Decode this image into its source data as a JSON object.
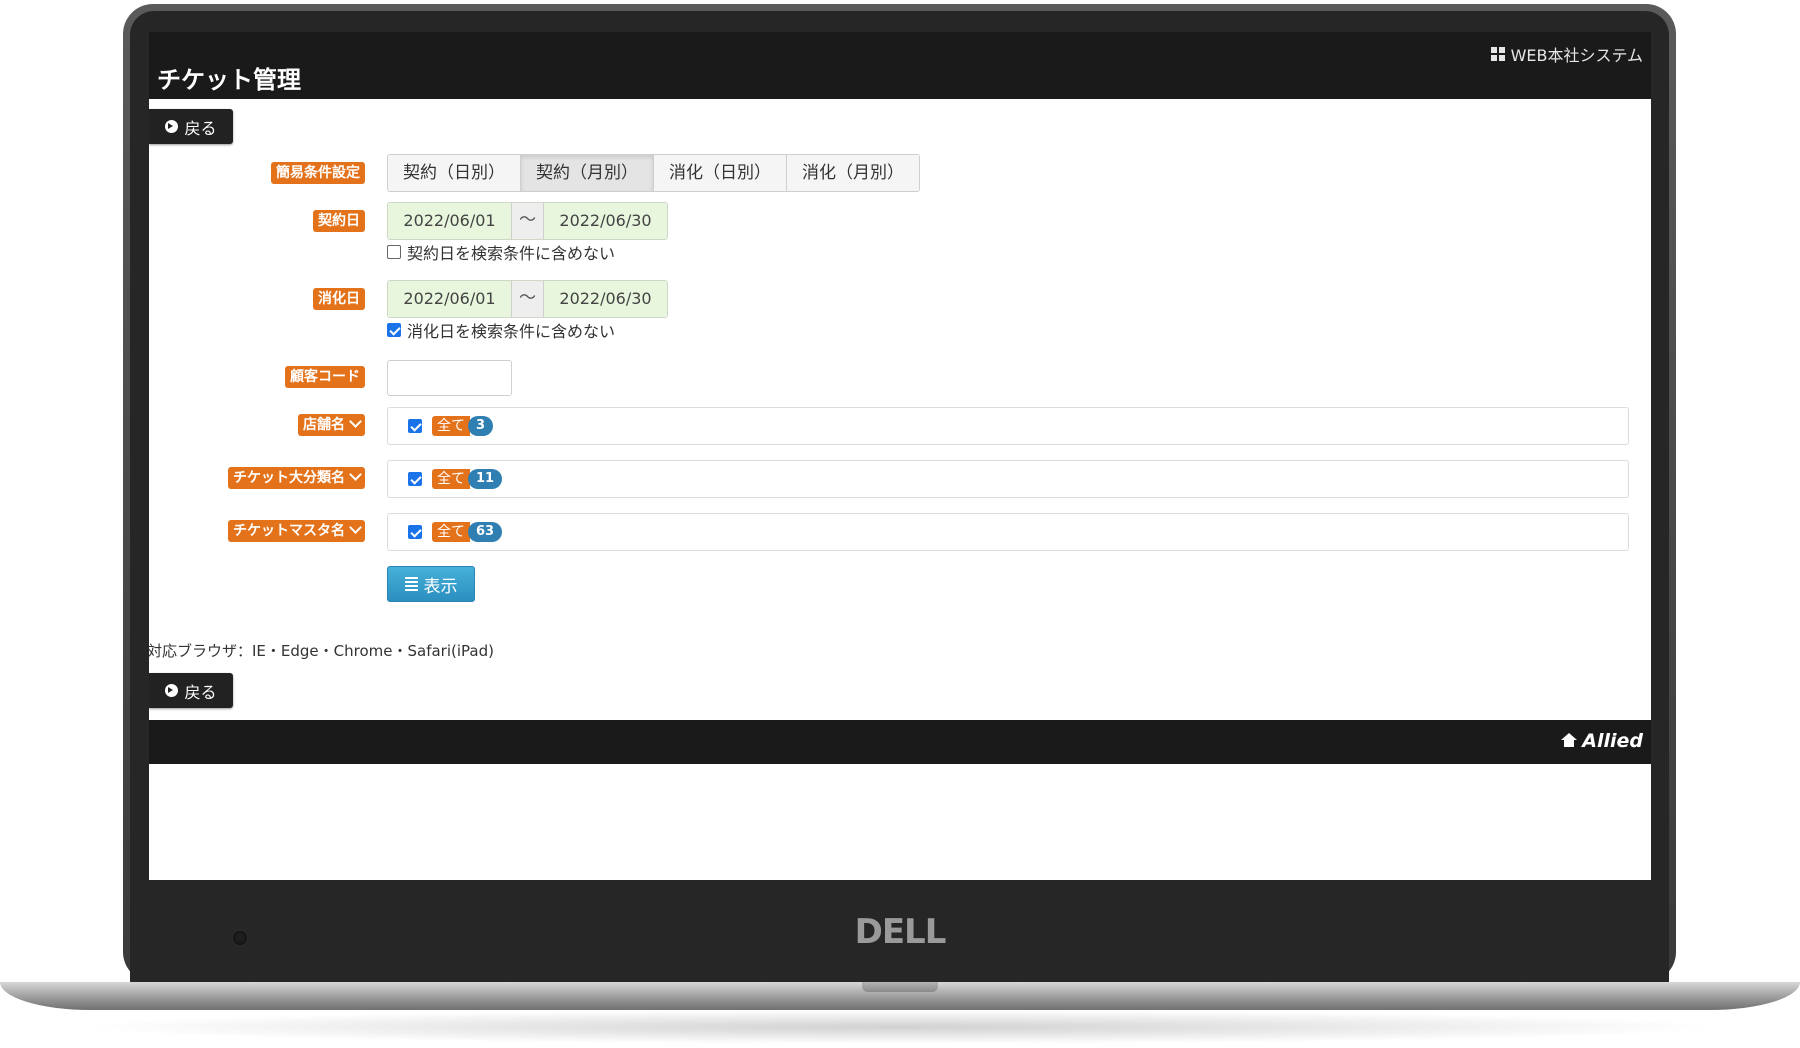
{
  "header": {
    "title": "チケット管理",
    "system_link": "WEB本社システム"
  },
  "back_label": "戻る",
  "quick_filter": {
    "label": "簡易条件設定",
    "options": [
      "契約（日別）",
      "契約（月別）",
      "消化（日別）",
      "消化（月別）"
    ],
    "selected": "契約（月別）"
  },
  "contract_date": {
    "label": "契約日",
    "from": "2022/06/01",
    "separator": "～",
    "to": "2022/06/30",
    "exclude_label": "契約日を検索条件に含めない",
    "exclude_checked": false
  },
  "consume_date": {
    "label": "消化日",
    "from": "2022/06/01",
    "separator": "～",
    "to": "2022/06/30",
    "exclude_label": "消化日を検索条件に含めない",
    "exclude_checked": true
  },
  "customer_code": {
    "label": "顧客コード",
    "value": ""
  },
  "store": {
    "label": "店舗名",
    "all_label": "全て",
    "count": "3"
  },
  "ticket_category": {
    "label": "チケット大分類名",
    "all_label": "全て",
    "count": "11"
  },
  "ticket_master": {
    "label": "チケットマスタ名",
    "all_label": "全て",
    "count": "63"
  },
  "show_button": "表示",
  "browser_note": "対応ブラウザ：IE・Edge・Chrome・Safari(iPad)",
  "footer": {
    "brand": "Allied"
  },
  "device": {
    "brand": "DELL"
  }
}
